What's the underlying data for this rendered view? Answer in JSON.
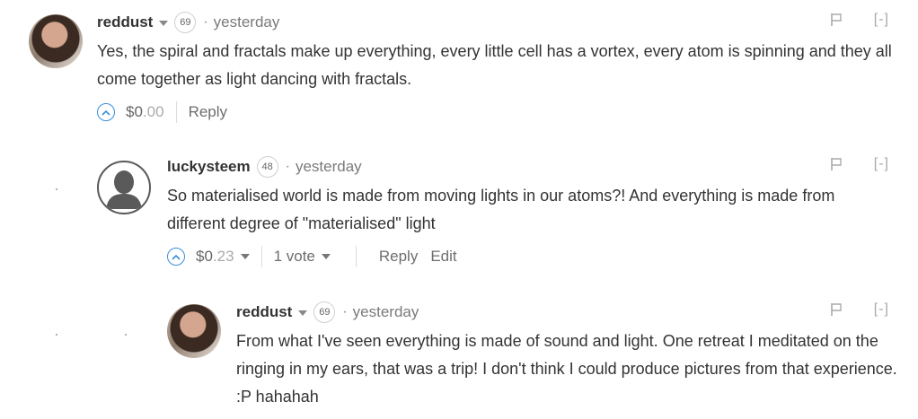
{
  "comments": [
    {
      "author": "reddust",
      "reputation": "69",
      "separator": "·",
      "time": "yesterday",
      "collapse": "[-]",
      "body": "Yes, the spiral and fractals make up everything, every little cell has a vortex, every atom is spinning and they all come together as light dancing with fractals.",
      "payout_main": "$0",
      "payout_cents": ".00",
      "reply": "Reply"
    },
    {
      "author": "luckysteem",
      "reputation": "48",
      "separator": "·",
      "time": "yesterday",
      "collapse": "[-]",
      "body": "So materialised world is made from moving lights in our atoms?! And everything is made from different degree of \"materialised\" light",
      "payout_main": "$0",
      "payout_cents": ".23",
      "votes": "1 vote",
      "reply": "Reply",
      "edit": "Edit"
    },
    {
      "author": "reddust",
      "reputation": "69",
      "separator": "·",
      "time": "yesterday",
      "collapse": "[-]",
      "body": "From what I've seen everything is made of sound and light. One retreat I meditated on the ringing in my ears, that was a trip! I don't think I could produce pictures from that experience. :P hahahah"
    }
  ],
  "icons": {
    "upvote": "chevron-up-icon",
    "flag": "flag-icon",
    "dropdown": "caret-down-icon",
    "default_avatar": "user-silhouette-icon"
  },
  "colors": {
    "accent": "#3a8ed8",
    "text": "#333333",
    "muted": "#7a7a7a"
  }
}
